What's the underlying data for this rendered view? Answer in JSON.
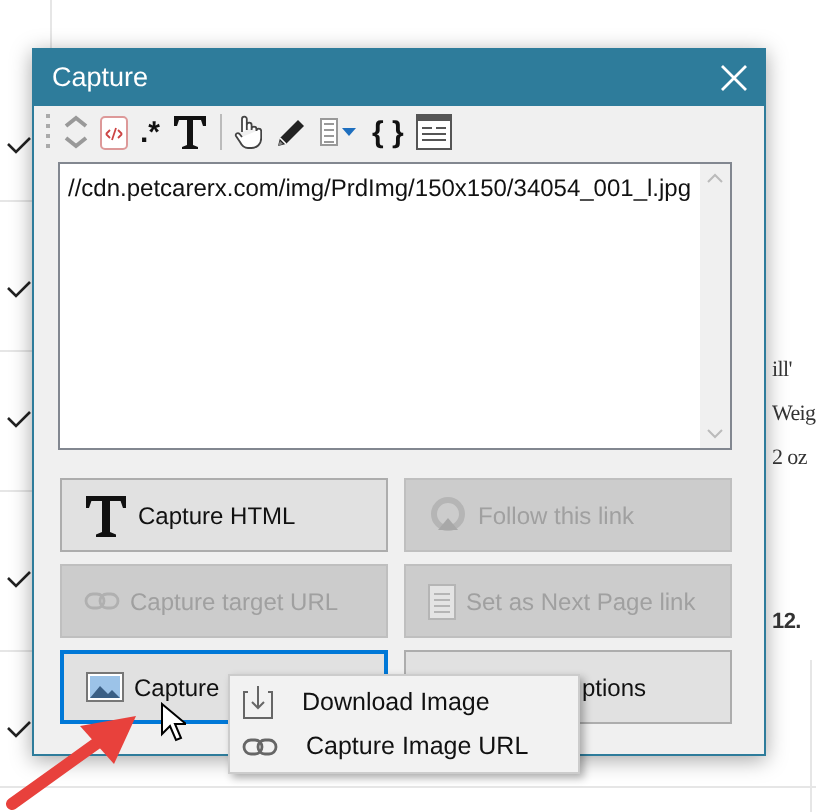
{
  "background_text": [
    {
      "text": "ill'",
      "bold": false
    },
    {
      "text": "Weig",
      "bold": false
    },
    {
      "text": "2 oz",
      "bold": false
    },
    {
      "text": "12.",
      "bold": true
    }
  ],
  "window": {
    "title": "Capture"
  },
  "toolbar": [
    {
      "kind": "chevrons"
    },
    {
      "kind": "html"
    },
    {
      "kind": "glyph",
      "text": ".*"
    },
    {
      "kind": "bigt"
    },
    {
      "kind": "separator"
    },
    {
      "kind": "hand"
    },
    {
      "kind": "pencil"
    },
    {
      "kind": "listdrop"
    },
    {
      "kind": "glyph",
      "text": "{ }"
    },
    {
      "kind": "form"
    }
  ],
  "text_area": {
    "value": "//cdn.petcarerx.com/img/PrdImg/150x150/34054_001_l.jpg"
  },
  "buttons": [
    {
      "label": "Capture HTML",
      "disabled": false,
      "focused": false
    },
    {
      "label": "Follow this link",
      "disabled": true,
      "focused": false
    },
    {
      "label": "Capture target URL",
      "disabled": true,
      "focused": false
    },
    {
      "label": "Set as Next Page link",
      "disabled": true,
      "focused": false
    },
    {
      "label": "Capture",
      "disabled": false,
      "focused": true
    },
    {
      "label": "ptions",
      "disabled": false,
      "focused": false,
      "covered": true
    }
  ],
  "menu": [
    {
      "label": "Download Image"
    },
    {
      "label": "Capture Image URL"
    }
  ]
}
